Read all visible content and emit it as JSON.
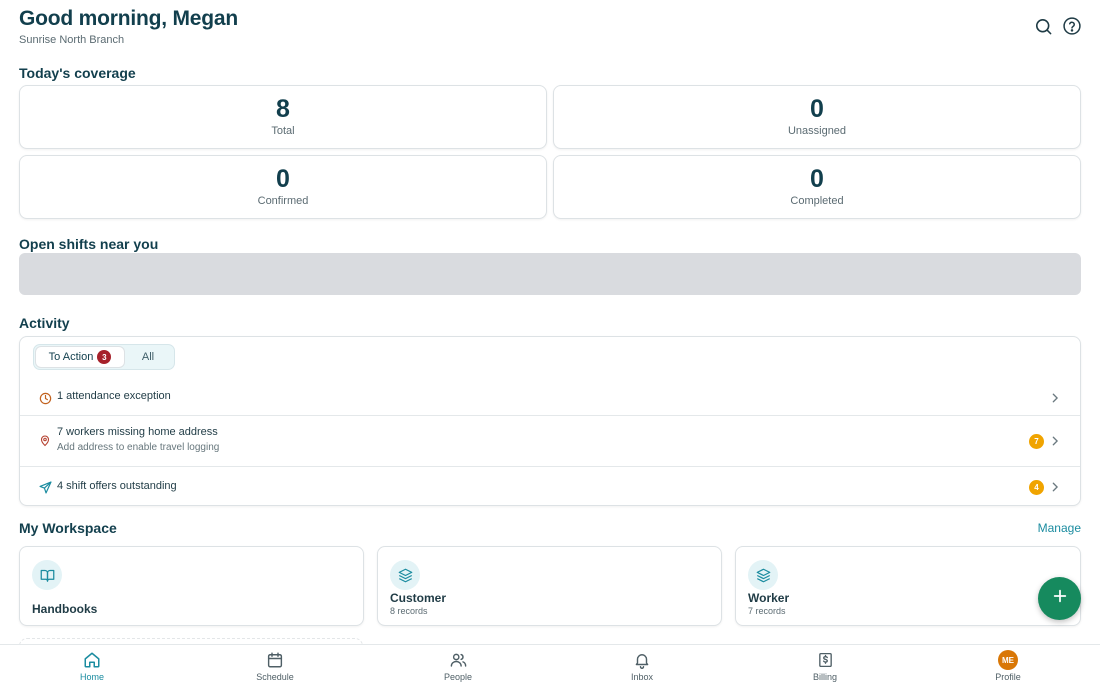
{
  "header": {
    "greeting": "Good morning, Megan",
    "branch": "Sunrise North Branch",
    "search_icon": "search-icon",
    "help_icon": "help-icon"
  },
  "coverage": {
    "title": "Today's coverage",
    "cards": [
      {
        "value": "8",
        "label": "Total"
      },
      {
        "value": "0",
        "label": "Unassigned"
      },
      {
        "value": "0",
        "label": "Confirmed"
      },
      {
        "value": "0",
        "label": "Completed"
      }
    ]
  },
  "open_shifts": {
    "title": "Open shifts near you"
  },
  "activity": {
    "title": "Activity",
    "tabs": [
      {
        "label": "To Action",
        "badge": "3",
        "active": true
      },
      {
        "label": "All",
        "active": false
      }
    ],
    "items": [
      {
        "icon": "clock-icon",
        "title": "1 attendance exception",
        "subtitle": "",
        "badge": ""
      },
      {
        "icon": "map-pin-icon",
        "title": "7 workers missing home address",
        "subtitle": "Add address to enable travel logging",
        "badge": "7"
      },
      {
        "icon": "send-icon",
        "title": "4 shift offers outstanding",
        "subtitle": "",
        "badge": "4"
      }
    ]
  },
  "workspace": {
    "title": "My Workspace",
    "manage_label": "Manage",
    "cards": [
      {
        "icon": "book-open-icon",
        "title": "Handbooks",
        "subtitle": ""
      },
      {
        "icon": "layers-icon",
        "title": "Customer",
        "subtitle": "8 records"
      },
      {
        "icon": "layers-icon",
        "title": "Worker",
        "subtitle": "7 records"
      }
    ]
  },
  "fab": {
    "icon": "plus-icon"
  },
  "bottom_nav": {
    "items": [
      {
        "label": "Home",
        "icon": "home-icon",
        "active": true
      },
      {
        "label": "Schedule",
        "icon": "calendar-icon",
        "active": false
      },
      {
        "label": "People",
        "icon": "users-icon",
        "active": false
      },
      {
        "label": "Inbox",
        "icon": "bell-icon",
        "active": false
      },
      {
        "label": "Billing",
        "icon": "dollar-receipt-icon",
        "active": false
      },
      {
        "label": "Profile",
        "icon": "avatar",
        "active": false,
        "initials": "ME"
      }
    ]
  },
  "colors": {
    "primary_dark": "#123f4d",
    "accent_teal": "#1b8ca0",
    "fab_green": "#168a5e",
    "badge_red": "#a6212a",
    "badge_amber": "#f0a400",
    "avatar_orange": "#d97706"
  }
}
